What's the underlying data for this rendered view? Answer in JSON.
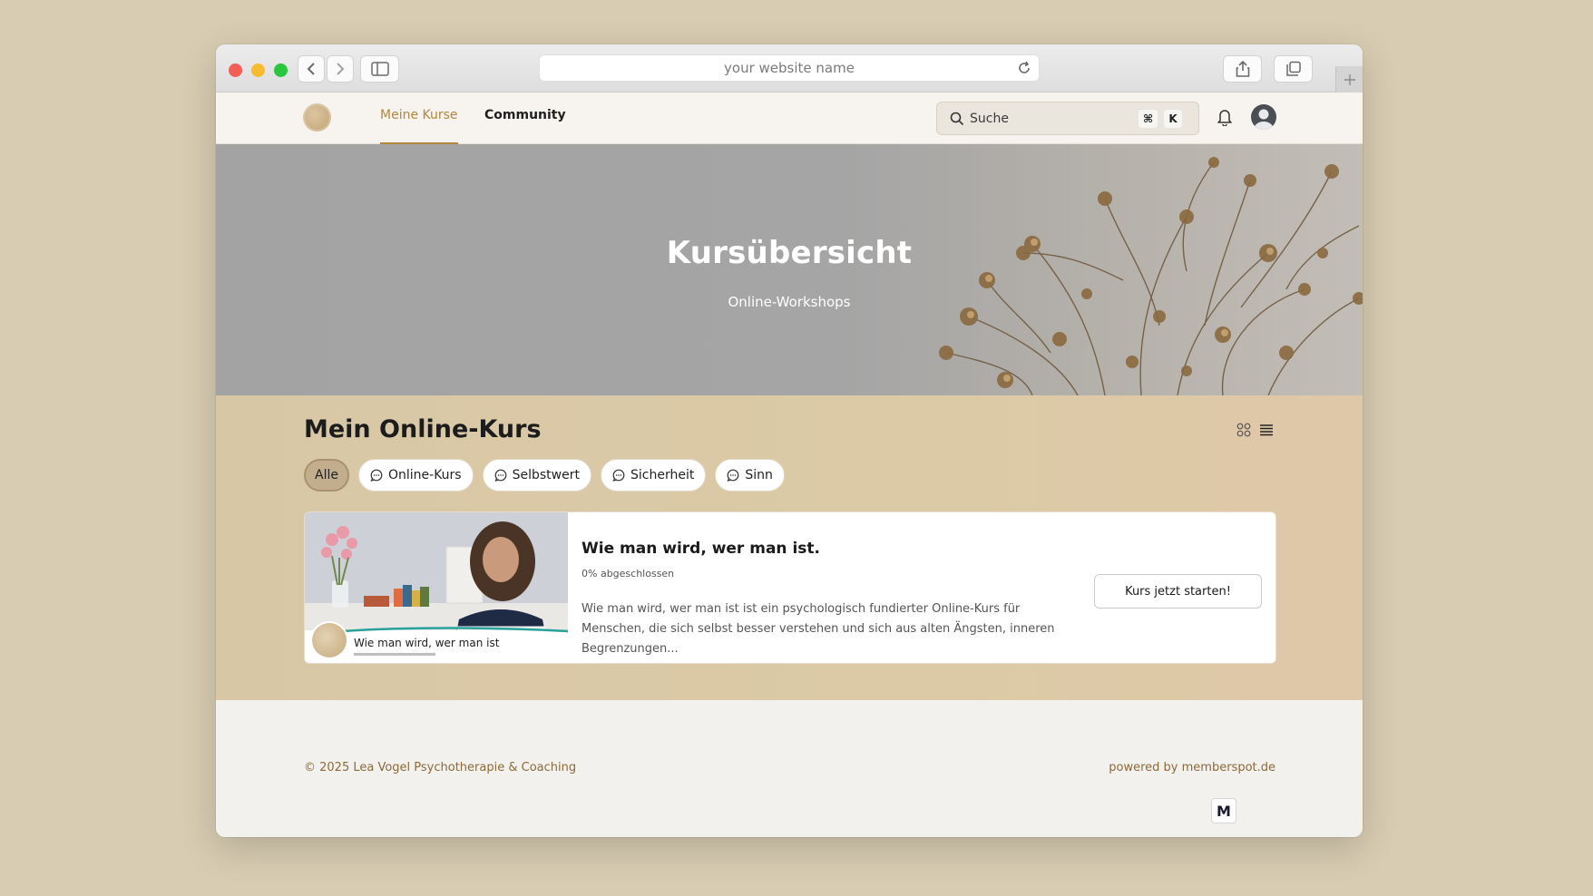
{
  "browser": {
    "url_placeholder": "your website name"
  },
  "nav": {
    "links": [
      {
        "label": "Meine Kurse",
        "active": true
      },
      {
        "label": "Community",
        "active": false
      }
    ],
    "search": {
      "placeholder": "Suche",
      "shortcut_mod": "⌘",
      "shortcut_key": "K"
    }
  },
  "hero": {
    "title": "Kursübersicht",
    "subtitle": "Online-Workshops"
  },
  "section": {
    "title": "Mein Online-Kurs",
    "filters": [
      {
        "label": "Alle",
        "active": true,
        "icon": ""
      },
      {
        "label": "Online-Kurs",
        "active": false,
        "icon": "chat-bubble-icon"
      },
      {
        "label": "Selbstwert",
        "active": false,
        "icon": "chat-bubble-icon"
      },
      {
        "label": "Sicherheit",
        "active": false,
        "icon": "chat-bubble-icon"
      },
      {
        "label": "Sinn",
        "active": false,
        "icon": "chat-bubble-icon"
      }
    ]
  },
  "course": {
    "title": "Wie man wird, wer man ist.",
    "progress": "0% abgeschlossen",
    "description": "Wie man wird, wer man ist ist ein psychologisch fundierter Online-Kurs für Menschen, die sich selbst besser verstehen und sich aus alten Ängsten, inneren Begrenzungen...",
    "thumb_caption": "Wie man wird, wer man ist",
    "button_label": "Kurs jetzt starten!"
  },
  "footer": {
    "copyright": "© 2025 Lea Vogel Psychotherapie & Coaching",
    "powered": "powered by memberspot.de",
    "badge": "M"
  },
  "colors": {
    "accent": "#b2873f",
    "background": "#d8ccb2",
    "section_bg": "#dccaa6"
  }
}
